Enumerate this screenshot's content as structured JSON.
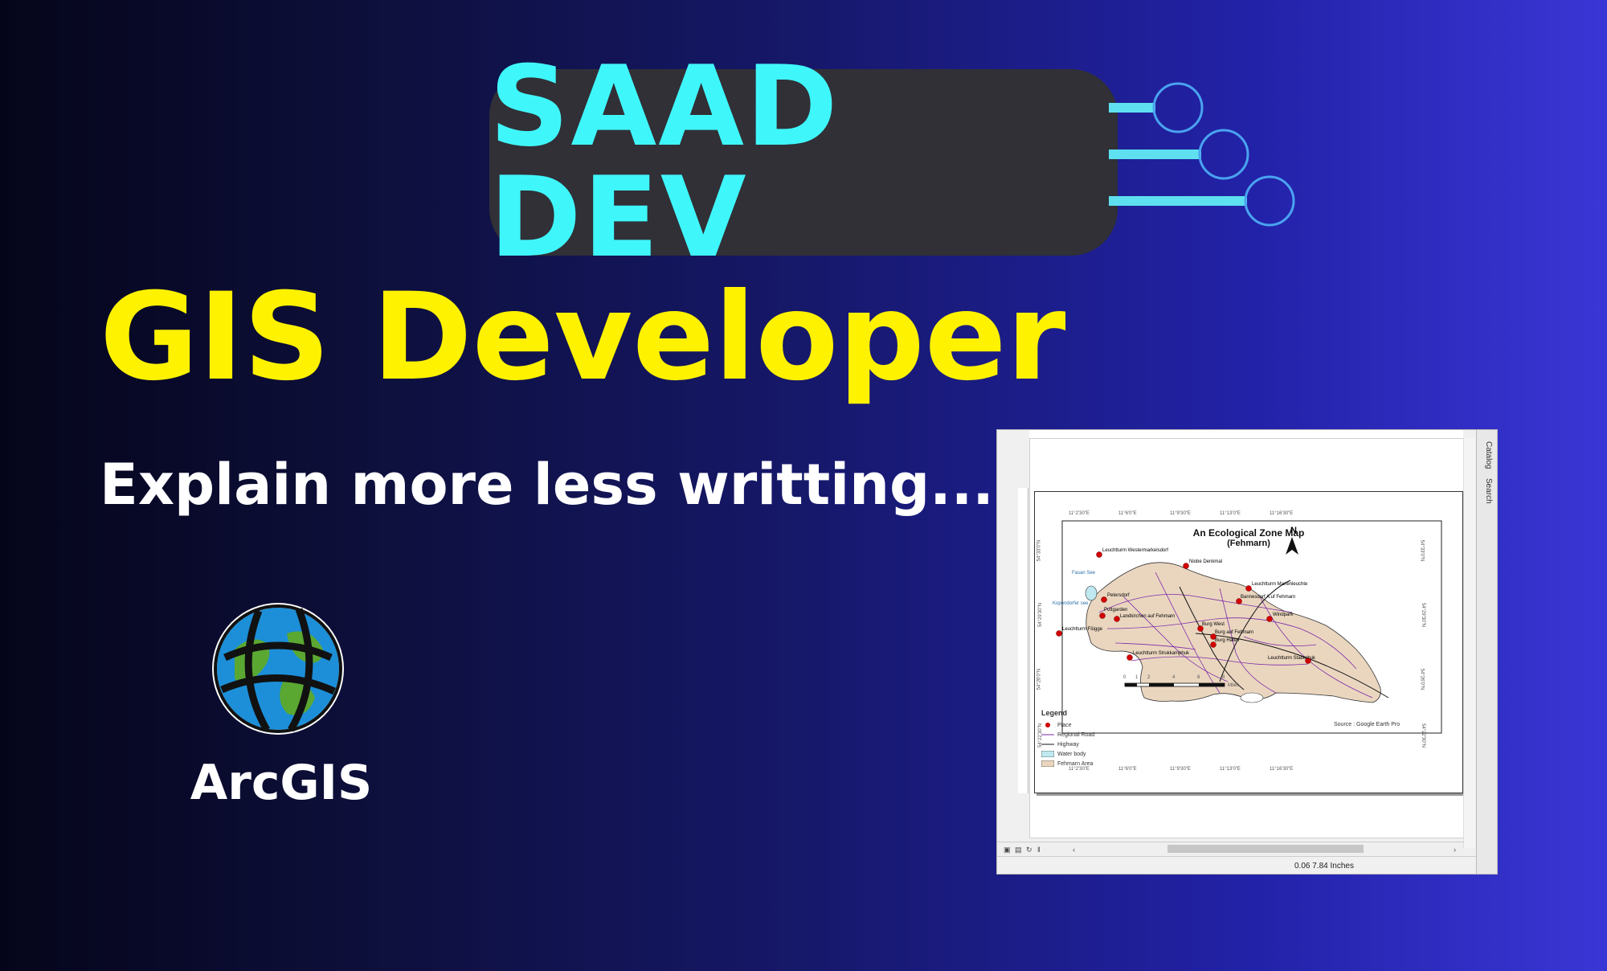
{
  "brand": {
    "name": "SAAD DEV",
    "color": "#3ff7fb"
  },
  "headline": "GIS Developer",
  "subline": "Explain more less writting.....",
  "logo": {
    "label": "ArcGIS",
    "icon": "globe-icon"
  },
  "screenshot": {
    "side_tabs": [
      "Catalog",
      "Search"
    ],
    "status": "0.06  7.84 Inches",
    "map": {
      "title": "An Ecological Zone Map",
      "subtitle": "(Fehmarn)",
      "north": "N",
      "top_labels": [
        "11°2'30\"E",
        "11°6'0\"E",
        "11°9'30\"E",
        "11°13'0\"E",
        "11°16'30\"E"
      ],
      "bottom_labels": [
        "11°2'30\"E",
        "11°6'0\"E",
        "11°9'30\"E",
        "11°13'0\"E",
        "11°16'30\"E"
      ],
      "left_labels": [
        "54°33'0\"N",
        "54°29'30\"N",
        "54°26'0\"N",
        "54°22'30\"N"
      ],
      "right_labels": [
        "54°33'0\"N",
        "54°29'30\"N",
        "54°26'0\"N",
        "54°22'30\"N"
      ],
      "places": [
        "Leuchtturm Westermarkelsdorf",
        "Niobe Denkmal",
        "Leuchtturm Marienleuchte",
        "Bannesdorf A.uf Fehmarn",
        "Windpark",
        "Petersdorf",
        "Puttgarden",
        "Landkirchen auf Fehmarn",
        "Burg West",
        "Burg auf Fehmarn",
        "Burg Hafen",
        "Leuchtturm Flügge",
        "Leuchtturm Strukkamphuk",
        "Leuchtturm Staberhuk"
      ],
      "water_labels": [
        "Fasan See",
        "Kopendorfer see"
      ],
      "legend": {
        "title": "Legend",
        "items": [
          "Place",
          "Regional Road",
          "Highway",
          "Water body",
          "Fehmarn Area"
        ]
      },
      "scale": {
        "ticks": [
          "0",
          "1",
          "2",
          "4",
          "6",
          "8"
        ],
        "unit": "Miles"
      },
      "source": "Source : Google Earth Pro"
    }
  }
}
